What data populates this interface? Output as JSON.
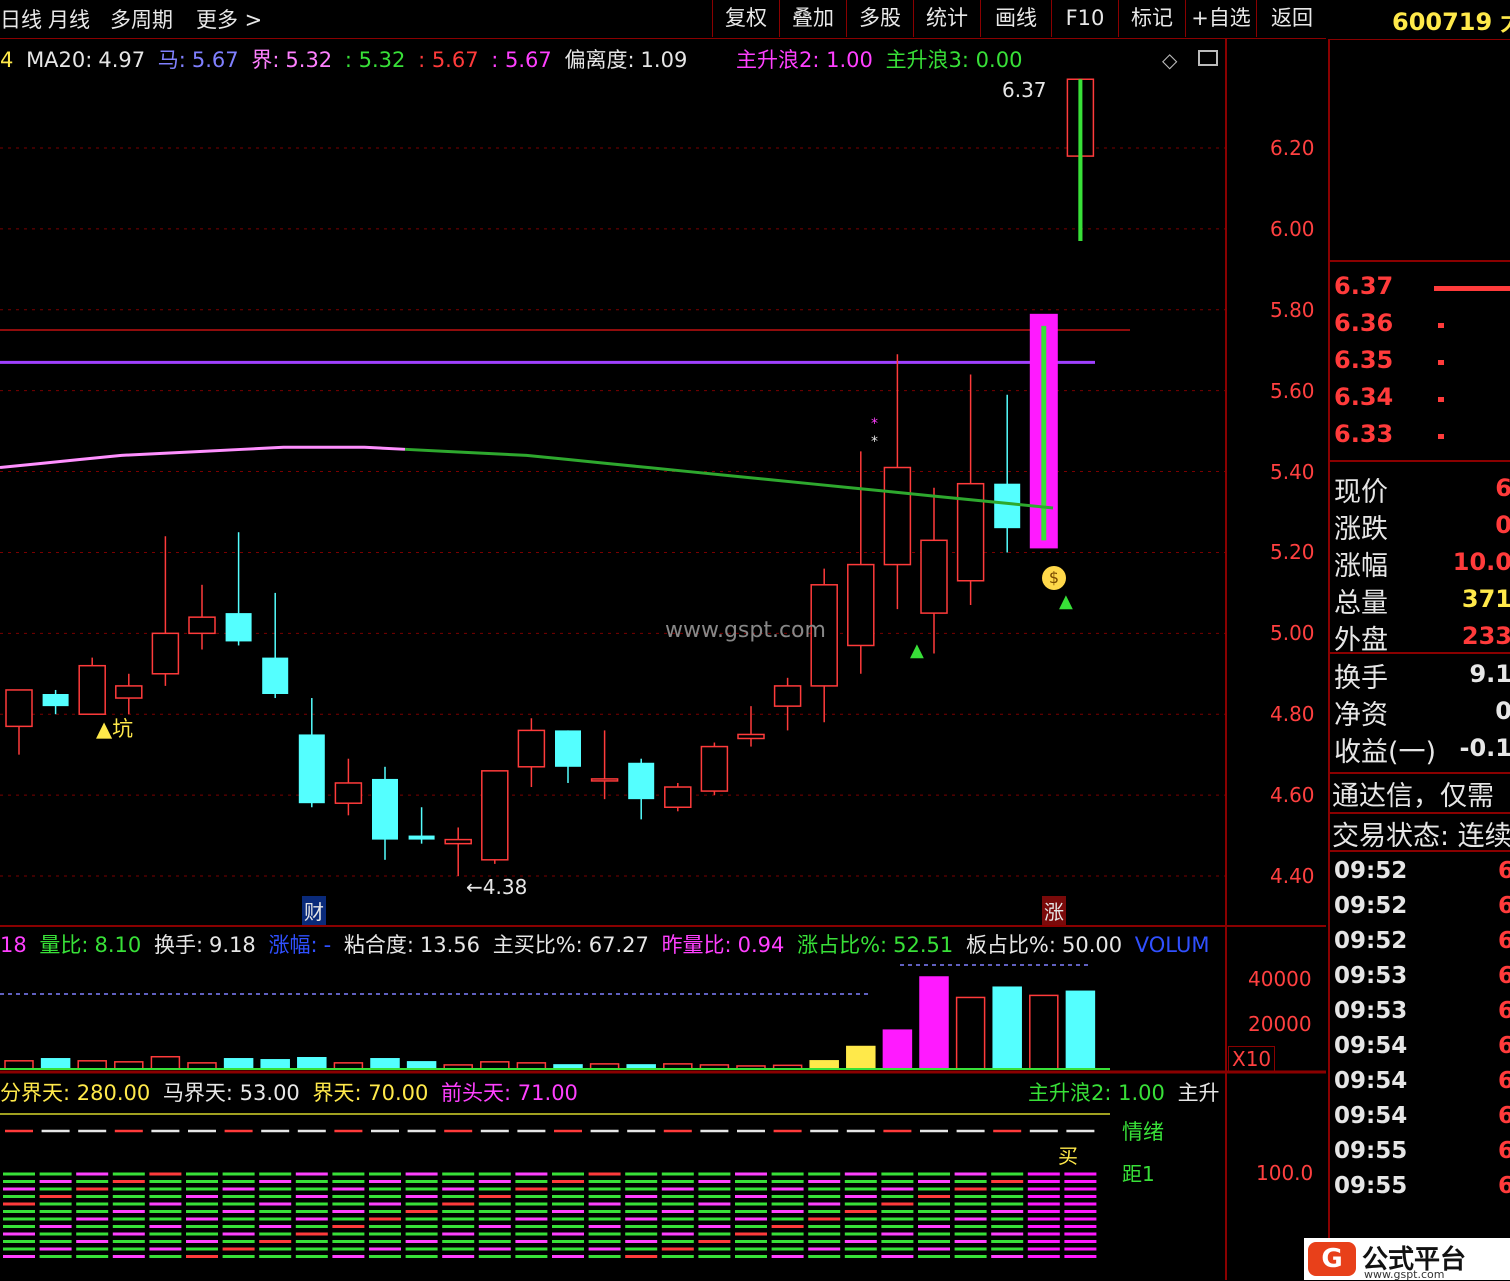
{
  "toolbar": {
    "left_items": [
      "日线",
      "月线",
      "多周期",
      "更多 >"
    ],
    "buttons": [
      "复权",
      "叠加",
      "多股",
      "统计",
      "画线",
      "F10",
      "标记",
      "+自选",
      "返回"
    ]
  },
  "ticker": "600719 大",
  "main_info": {
    "ma20_label": "MA20:",
    "ma20": "4.97",
    "ma_label": "马:",
    "ma_val": "5.67",
    "jie_label": "界:",
    "jie_val": "5.32",
    "v1": ": 5.32",
    "v2": ": 5.67",
    "v3": ": 5.67",
    "pld_label": "偏离度:",
    "pld": "1.09",
    "wave2": "主升浪2: 1.00",
    "wave3": "主升浪3: 0.00"
  },
  "price_axis": [
    "6.20",
    "6.00",
    "5.80",
    "5.60",
    "5.40",
    "5.20",
    "5.00",
    "4.80",
    "4.60",
    "4.40"
  ],
  "annotations": {
    "high": "6.37",
    "low": "4.38",
    "keng": "▲坑",
    "cai": "财",
    "zhang": "涨",
    "watermark": "www.gspt.com"
  },
  "vol_info": {
    "lb_label": "量比:",
    "lb": "8.10",
    "hs_label": "换手:",
    "hs": "9.18",
    "zf_label": "涨幅:",
    "zf": "-",
    "nhd_label": "粘合度:",
    "nhd": "13.56",
    "zmb_label": "主买比%:",
    "zmb": "67.27",
    "zlb_label": "昨量比:",
    "zlb": "0.94",
    "zzb_label": "涨占比%:",
    "zzb": "52.51",
    "bzb_label": "板占比%:",
    "bzb": "50.00",
    "volum": "VOLUM"
  },
  "vol_axis": [
    "40000",
    "20000"
  ],
  "vol_unit": "X10",
  "ind_info": {
    "fjt": "分界天: 280.00",
    "mjt": "马界天: 53.00",
    "jt": "界天: 70.00",
    "qtt": "前头天: 71.00",
    "zsl2": "主升浪2: 1.00",
    "zs": "主升"
  },
  "ind_axis": "100.0",
  "ind_labels": {
    "qingxu": "情绪",
    "mai": "买",
    "ju": "距1"
  },
  "orderbook": [
    {
      "price": "6.37"
    },
    {
      "price": "6.36"
    },
    {
      "price": "6.35"
    },
    {
      "price": "6.34"
    },
    {
      "price": "6.33"
    }
  ],
  "quote": [
    {
      "label": "现价",
      "value": "6",
      "color": "#ff3b3b"
    },
    {
      "label": "涨跌",
      "value": "0",
      "color": "#ff3b3b"
    },
    {
      "label": "涨幅",
      "value": "10.0",
      "color": "#ff3b3b"
    },
    {
      "label": "总量",
      "value": "371",
      "color": "#ffe94a"
    },
    {
      "label": "外盘",
      "value": "233",
      "color": "#ff3b3b"
    },
    {
      "label": "换手",
      "value": "9.1",
      "color": "#e6e6e6"
    },
    {
      "label": "净资",
      "value": "0",
      "color": "#e6e6e6"
    },
    {
      "label": "收益(一)",
      "value": "-0.1",
      "color": "#e6e6e6"
    }
  ],
  "notice": "通达信，仅需",
  "trade_state": "交易状态: 连续",
  "ticks": [
    {
      "t": "09:52",
      "v": "6"
    },
    {
      "t": "09:52",
      "v": "6"
    },
    {
      "t": "09:52",
      "v": "6"
    },
    {
      "t": "09:53",
      "v": "6"
    },
    {
      "t": "09:53",
      "v": "6"
    },
    {
      "t": "09:54",
      "v": "6"
    },
    {
      "t": "09:54",
      "v": "6"
    },
    {
      "t": "09:54",
      "v": "6"
    },
    {
      "t": "09:55",
      "v": "6"
    },
    {
      "t": "09:55",
      "v": "6"
    }
  ],
  "logo": {
    "text": "公式平台",
    "url": "www.gspt.com"
  },
  "colors": {
    "up": "#ff3b3b",
    "down": "#54ffff",
    "ma_green": "#2ea82e",
    "purple": "#a040ff",
    "magenta": "#ff1aff",
    "yellow": "#ffe94a"
  },
  "chart_data": {
    "type": "candlestick",
    "ylim": [
      4.3,
      6.45
    ],
    "candles": [
      {
        "o": 4.77,
        "c": 4.86,
        "h": 4.86,
        "l": 4.7
      },
      {
        "o": 4.85,
        "c": 4.82,
        "h": 4.86,
        "l": 4.8
      },
      {
        "o": 4.8,
        "c": 4.92,
        "h": 4.94,
        "l": 4.8
      },
      {
        "o": 4.84,
        "c": 4.87,
        "h": 4.9,
        "l": 4.8
      },
      {
        "o": 4.9,
        "c": 5.0,
        "h": 5.24,
        "l": 4.87
      },
      {
        "o": 5.0,
        "c": 5.04,
        "h": 5.12,
        "l": 4.96
      },
      {
        "o": 5.05,
        "c": 4.98,
        "h": 5.25,
        "l": 4.97
      },
      {
        "o": 4.94,
        "c": 4.85,
        "h": 5.1,
        "l": 4.84
      },
      {
        "o": 4.75,
        "c": 4.58,
        "h": 4.84,
        "l": 4.57
      },
      {
        "o": 4.58,
        "c": 4.63,
        "h": 4.69,
        "l": 4.55
      },
      {
        "o": 4.64,
        "c": 4.49,
        "h": 4.67,
        "l": 4.44
      },
      {
        "o": 4.5,
        "c": 4.49,
        "h": 4.57,
        "l": 4.48
      },
      {
        "o": 4.48,
        "c": 4.49,
        "h": 4.52,
        "l": 4.4
      },
      {
        "o": 4.44,
        "c": 4.66,
        "h": 4.66,
        "l": 4.43
      },
      {
        "o": 4.67,
        "c": 4.76,
        "h": 4.79,
        "l": 4.62
      },
      {
        "o": 4.76,
        "c": 4.67,
        "h": 4.76,
        "l": 4.63
      },
      {
        "o": 4.64,
        "c": 4.64,
        "h": 4.76,
        "l": 4.59
      },
      {
        "o": 4.68,
        "c": 4.59,
        "h": 4.69,
        "l": 4.54
      },
      {
        "o": 4.57,
        "c": 4.62,
        "h": 4.63,
        "l": 4.56
      },
      {
        "o": 4.61,
        "c": 4.72,
        "h": 4.73,
        "l": 4.6
      },
      {
        "o": 4.74,
        "c": 4.75,
        "h": 4.82,
        "l": 4.72
      },
      {
        "o": 4.82,
        "c": 4.87,
        "h": 4.89,
        "l": 4.76
      },
      {
        "o": 4.87,
        "c": 5.12,
        "h": 5.16,
        "l": 4.78
      },
      {
        "o": 4.97,
        "c": 5.17,
        "h": 5.45,
        "l": 4.9
      },
      {
        "o": 5.17,
        "c": 5.41,
        "h": 5.69,
        "l": 5.06
      },
      {
        "o": 5.05,
        "c": 5.23,
        "h": 5.36,
        "l": 4.95
      },
      {
        "o": 5.13,
        "c": 5.37,
        "h": 5.64,
        "l": 5.07
      },
      {
        "o": 5.37,
        "c": 5.26,
        "h": 5.59,
        "l": 5.2
      },
      {
        "o": 5.21,
        "c": 5.79,
        "h": 5.79,
        "l": 5.21
      },
      {
        "o": 6.37,
        "c": 6.18,
        "h": 6.37,
        "l": 5.97
      }
    ],
    "ma_line": [
      5.41,
      5.42,
      5.43,
      5.44,
      5.445,
      5.45,
      5.455,
      5.46,
      5.46,
      5.46,
      5.455,
      5.45,
      5.445,
      5.44,
      5.43,
      5.42,
      5.41,
      5.4,
      5.39,
      5.38,
      5.37,
      5.36,
      5.35,
      5.34,
      5.33,
      5.32,
      5.31
    ],
    "purple_level": 5.67,
    "red_level": 5.75,
    "volume": [
      4000,
      5000,
      4000,
      3500,
      6000,
      3000,
      5000,
      4500,
      5500,
      3000,
      5000,
      3500,
      2000,
      3500,
      3000,
      2000,
      2500,
      2000,
      2500,
      2000,
      1500,
      1800,
      4000,
      11000,
      19000,
      45000,
      35000,
      40000,
      36000,
      38000
    ]
  }
}
